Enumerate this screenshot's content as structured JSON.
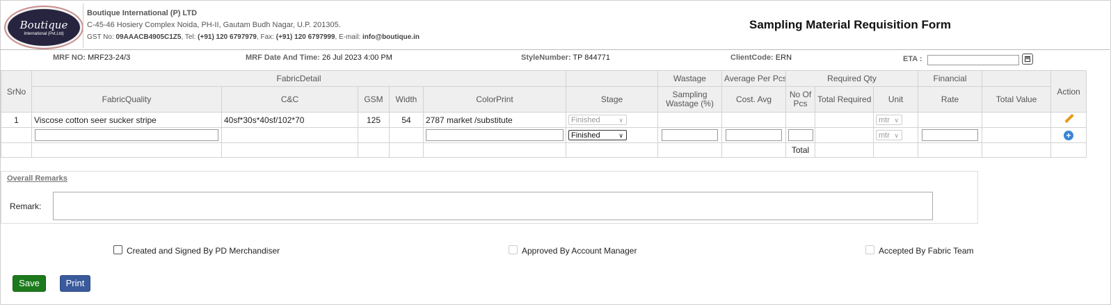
{
  "company": {
    "logo_line1": "Boutique",
    "logo_line2": "International (Pvt.Ltd)",
    "name": "Boutique International (P) LTD",
    "address": "C-45-46 Hosiery Complex Noida, PH-II, Gautam Budh Nagar, U.P. 201305.",
    "gst_label": "GST No:",
    "gst_value": "09AAACB4905C1Z5",
    "tel_label": ", Tel:",
    "tel_value": "(+91) 120 6797979",
    "fax_label": ", Fax:",
    "fax_value": "(+91) 120 6797999",
    "email_label": ", E-mail:",
    "email_value": "info@boutique.in"
  },
  "form_title": "Sampling Material Requisition Form",
  "info": {
    "mrf_no_label": "MRF NO:",
    "mrf_no": "MRF23-24/3",
    "mrf_date_label": "MRF Date And Time:",
    "mrf_date": "26 Jul 2023 4:00 PM",
    "style_label": "StyleNumber:",
    "style": "TP 844771",
    "client_label": "ClientCode:",
    "client": "ERN",
    "eta_label": "ETA :",
    "eta_value": ""
  },
  "table": {
    "group_headers": {
      "srno": "SrNo",
      "fabric_detail": "FabricDetail",
      "wastage": "Wastage",
      "avg_per_pcs": "Average Per Pcs",
      "required_qty": "Required Qty",
      "financial": "Financial",
      "action": "Action"
    },
    "columns": {
      "fabric_quality": "FabricQuality",
      "cc": "C&C",
      "gsm": "GSM",
      "width": "Width",
      "color_print": "ColorPrint",
      "stage": "Stage",
      "sampling_wastage": "Sampling Wastage (%)",
      "cost_avg": "Cost. Avg",
      "no_of_pcs": "No Of Pcs",
      "total_required": "Total Required",
      "unit": "Unit",
      "rate": "Rate",
      "total_value": "Total Value"
    },
    "row1": {
      "srno": "1",
      "fabric_quality": "Viscose cotton seer sucker stripe",
      "cc": "40sf*30s*40sf/102*70",
      "gsm": "125",
      "width": "54",
      "color_print": "2787 market /substitute",
      "stage": "Finished",
      "unit": "mtr"
    },
    "new_row": {
      "stage": "Finished",
      "unit": "mtr"
    },
    "total_label": "Total"
  },
  "remarks": {
    "heading": "Overall Remarks",
    "label": "Remark:",
    "value": ""
  },
  "approvals": {
    "created": "Created and Signed By PD Merchandiser",
    "approved": "Approved By Account Manager",
    "accepted": "Accepted By Fabric Team"
  },
  "buttons": {
    "save": "Save",
    "print": "Print"
  },
  "colors": {
    "save_button": "#1c7a1c",
    "print_button": "#3a5a9c",
    "header_bg": "#efefef",
    "logo_bg": "#26243f"
  }
}
